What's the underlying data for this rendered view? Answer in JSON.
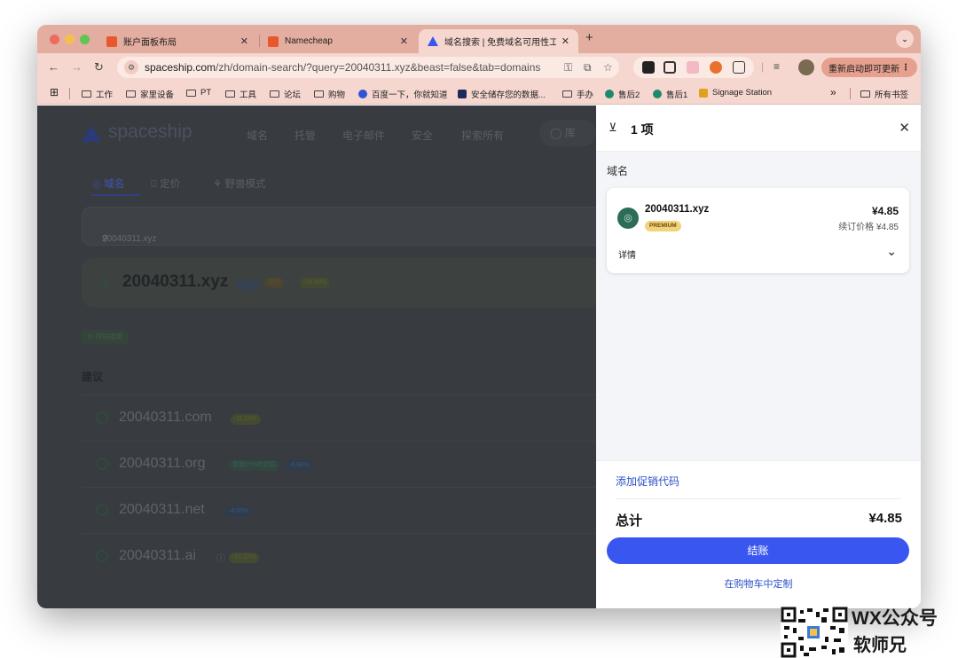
{
  "browser": {
    "tabs": [
      {
        "title": "账户面板布局",
        "active": false
      },
      {
        "title": "Namecheap",
        "active": false
      },
      {
        "title": "域名搜索 | 免费域名可用性工具",
        "active": true
      }
    ],
    "new_tab": "+",
    "url_host": "spaceship.com",
    "url_rest": "/zh/domain-search/?query=20040311.xyz&beast=false&tab=domains",
    "update_button": "重新启动即可更新",
    "bookmarks": [
      "工作",
      "家里设备",
      "PT",
      "工具",
      "论坛",
      "购物",
      "百度一下，你就知道",
      "安全储存您的数据...",
      "手办",
      "售后2",
      "售后1",
      "Signage Station"
    ],
    "bookmarks_overflow": "»",
    "all_bookmarks": "所有书签"
  },
  "site": {
    "logo": "spaceship",
    "nav": [
      "域名",
      "托管",
      "电子邮件",
      "安全",
      "探索所有",
      "库"
    ],
    "subtabs": [
      "域名",
      "定价",
      "野兽模式"
    ],
    "search_value": "20040311.xyz",
    "result": {
      "domain": "20040311.xyz",
      "status": "可用",
      "tag": "高级",
      "discount": "-28.00%"
    },
    "trusted_search": "可信搜索",
    "suggestions_title": "建议",
    "suggestions": [
      {
        "domain": "20040311.com",
        "tags": [
          "-11.14%"
        ]
      },
      {
        "domain": "20040311.org",
        "tags": [
          "享受27%的折扣",
          "-6.68%"
        ]
      },
      {
        "domain": "20040311.net",
        "tags": [
          "-4.55%"
        ]
      },
      {
        "domain": "20040311.ai",
        "tags": [
          "-21.22%"
        ]
      }
    ]
  },
  "cart": {
    "title": "1 项",
    "section_label": "域名",
    "item": {
      "domain": "20040311.xyz",
      "badge": "PREMIUM",
      "price": "¥4.85",
      "renewal": "续订价格 ¥4.85",
      "details": "详情"
    },
    "promo_link": "添加促销代码",
    "total_label": "总计",
    "total_value": "¥4.85",
    "checkout": "结账",
    "customize": "在购物车中定制"
  },
  "watermark": {
    "line1": "WX公众号",
    "line2": "软师兄"
  },
  "colors": {
    "tab_strip": "#e3ada0",
    "toolbar": "#f6d7cf",
    "accent": "#3a56f0",
    "overlay": "#383b40",
    "premium": "#f2d27b"
  }
}
